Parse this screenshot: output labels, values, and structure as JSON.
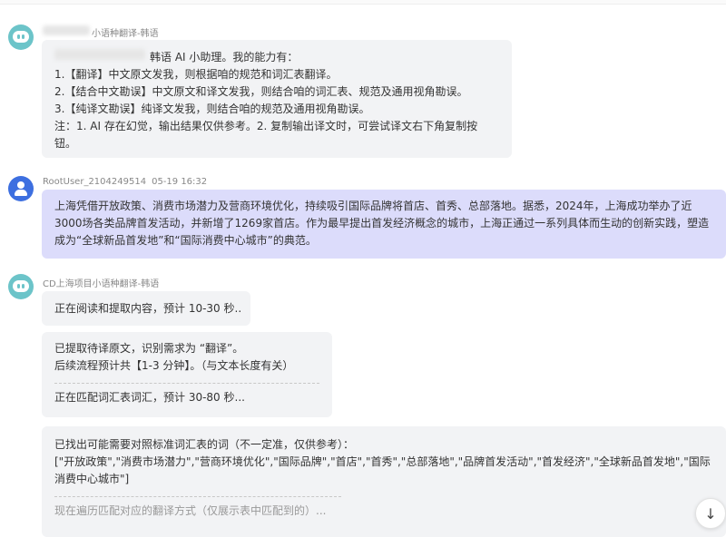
{
  "messages": {
    "intro": {
      "sender": "小语种翻译-韩语",
      "lines": [
        "韩语 AI 小助理。我的能力有：",
        "1.【翻译】中文原文发我，则根据咱的规范和词汇表翻译。",
        "2.【结合中文勘误】中文原文和译文发我，则结合咱的词汇表、规范及通用视角勘误。",
        "3.【纯译文勘误】纯译文发我，则结合咱的规范及通用视角勘误。",
        "注：1. AI 存在幻觉，输出结果仅供参考。2. 复制输出译文时，可尝试译文右下角复制按钮。"
      ]
    },
    "user": {
      "sender": "RootUser_2104249514",
      "time": "05-19 16:32",
      "text": "上海凭借开放政策、消费市场潜力及营商环境优化，持续吸引国际品牌将首店、首秀、总部落地。据悉，2024年，上海成功举办了近3000场各类品牌首发活动，并新增了1269家首店。作为最早提出首发经济概念的城市，上海正通过一系列具体而生动的创新实践，塑造成为“全球新品首发地”和“国际消费中心城市”的典范。"
    },
    "bot": {
      "sender": "CD上海项目小语种翻译-韩语",
      "reading": "正在阅读和提取内容，预计 10-30 秒..",
      "extracted": {
        "line1": "已提取待译原文，识别需求为 “翻译”。",
        "line2": "后续流程预计共【1-3 分钟】。（与文本长度有关）",
        "progress": "正在匹配词汇表词汇，预计 30-80 秒..."
      },
      "terms": {
        "intro": "已找出可能需要对照标准词汇表的词（不一定准，仅供参考）：",
        "list": "[\"开放政策\",\"消费市场潜力\",\"营商环境优化\",\"国际品牌\",\"首店\",\"首秀\",\"总部落地\",\"品牌首发活动\",\"首发经济\",\"全球新品首发地\",\"国际消费中心城市\"]",
        "status": "现在遍历匹配对应的翻译方式（仅展示表中匹配到的）..."
      }
    }
  },
  "icons": {
    "bot_avatar": "robot-icon",
    "user_avatar": "user-icon",
    "scroll_down": "arrow-down-icon",
    "scroll_down_glyph": "↓"
  },
  "colors": {
    "bot_bubble": "#f2f3f5",
    "user_bubble": "#dcdcfb",
    "bot_avatar": "#6cc4c9",
    "user_avatar": "#3d6fe0"
  }
}
